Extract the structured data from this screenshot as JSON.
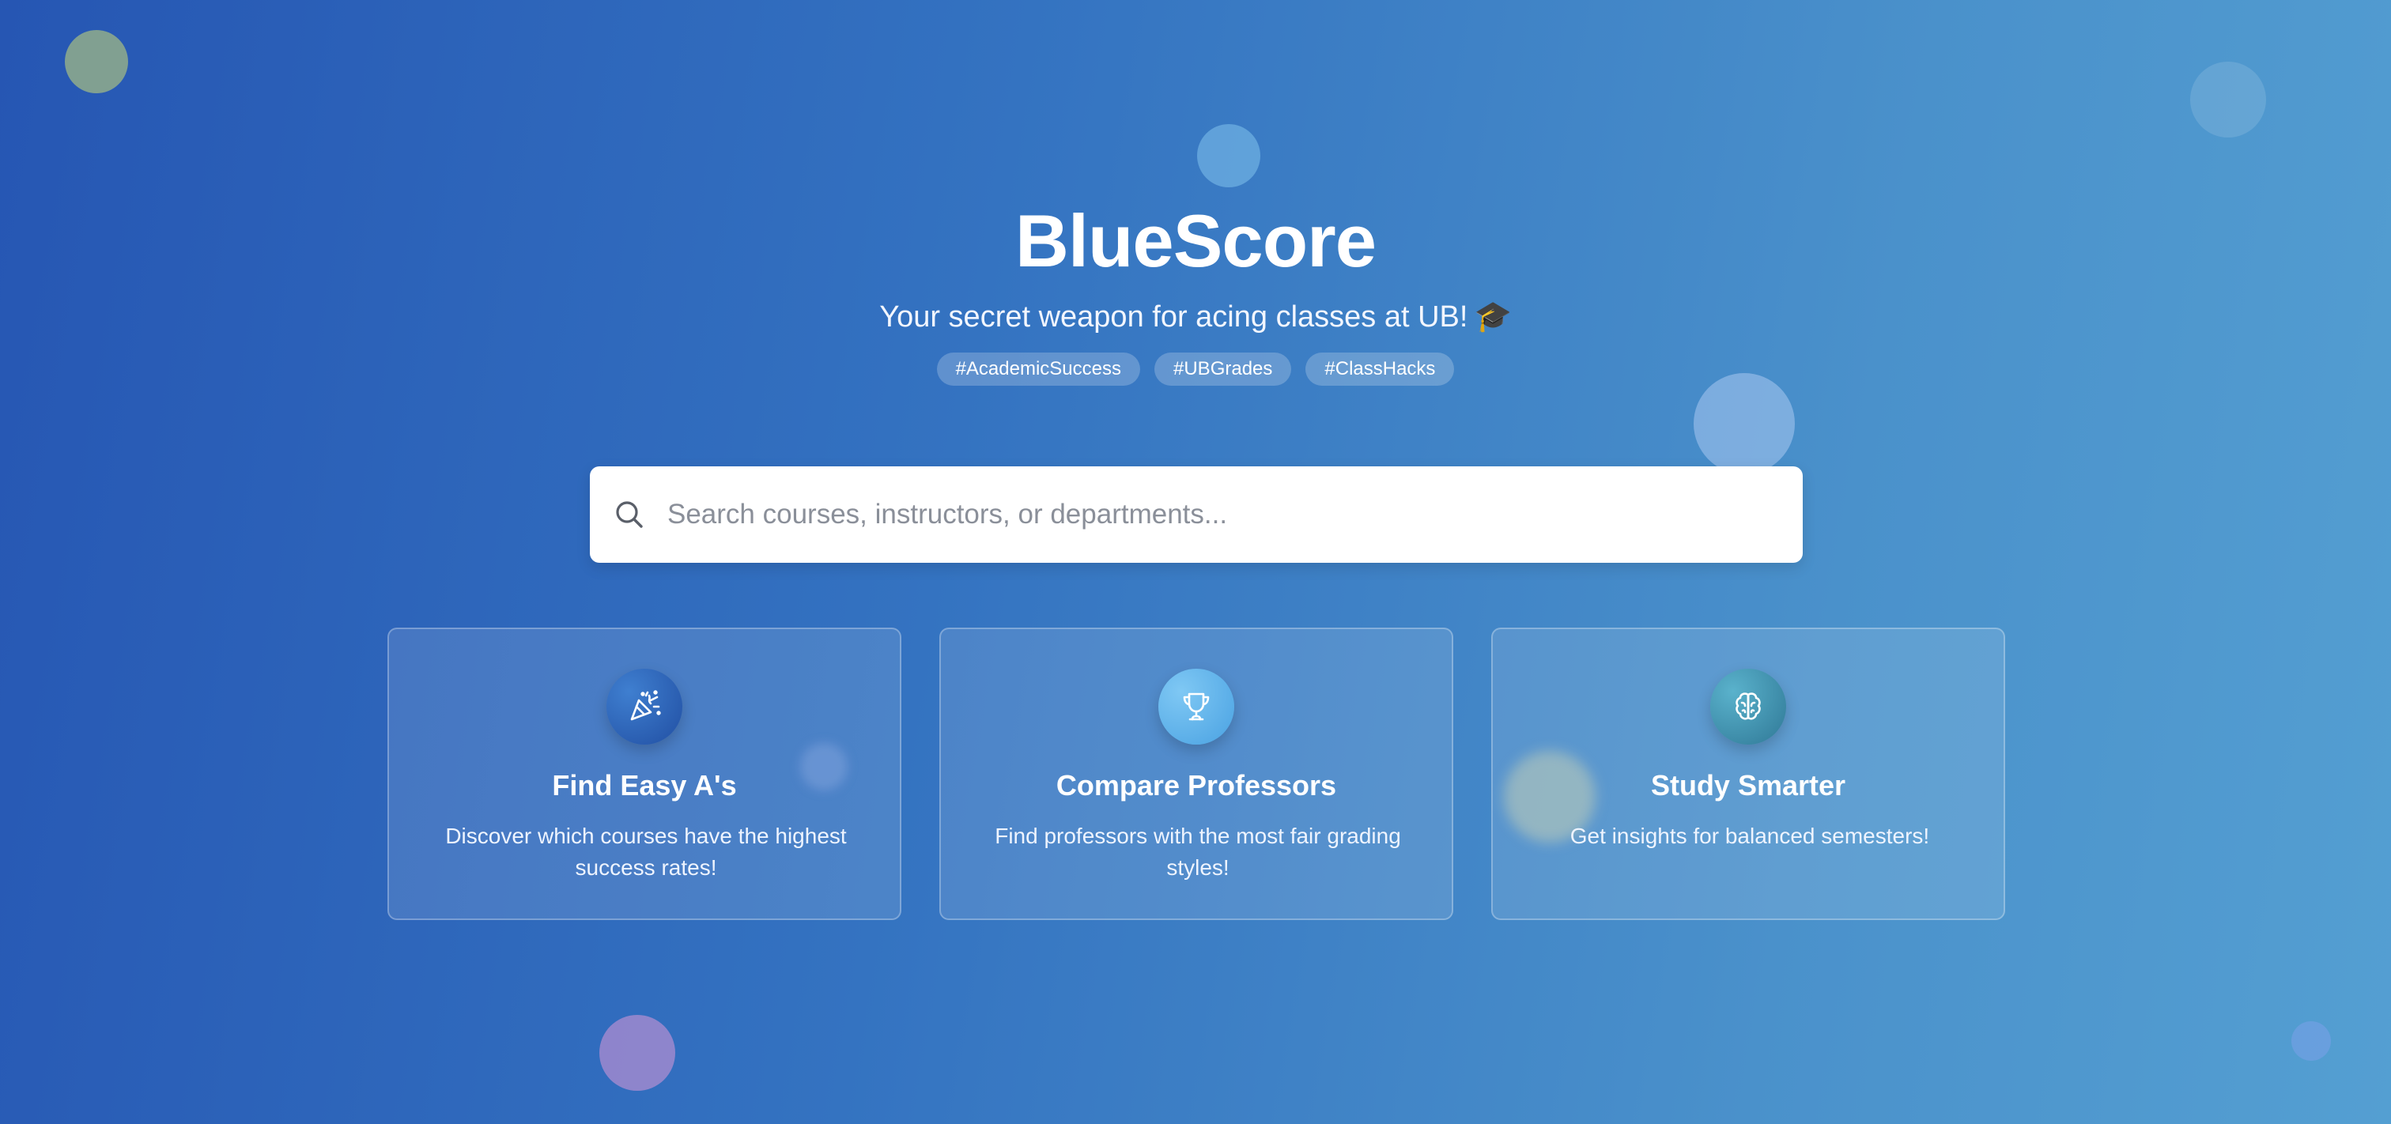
{
  "brand": {
    "title": "BlueScore",
    "tagline": "Your secret weapon for acing classes at UB!",
    "tagline_emoji": "🎓"
  },
  "tags": [
    "#AcademicSuccess",
    "#UBGrades",
    "#ClassHacks"
  ],
  "search": {
    "placeholder": "Search courses, instructors, or departments...",
    "value": "",
    "icon": "search-icon"
  },
  "features": [
    {
      "title": "Find Easy A's",
      "description": "Discover which courses have the highest success rates!",
      "icon": "party-popper-icon"
    },
    {
      "title": "Compare Professors",
      "description": "Find professors with the most fair grading styles!",
      "icon": "trophy-icon"
    },
    {
      "title": "Study Smarter",
      "description": "Get insights for balanced semesters!",
      "icon": "brain-icon"
    }
  ],
  "colors": {
    "background_start": "#2656b3",
    "background_end": "#549fd2",
    "card_icon_1": "#2a5fb6",
    "card_icon_2": "#5cb2ea",
    "card_icon_3": "#3f8fb0"
  }
}
